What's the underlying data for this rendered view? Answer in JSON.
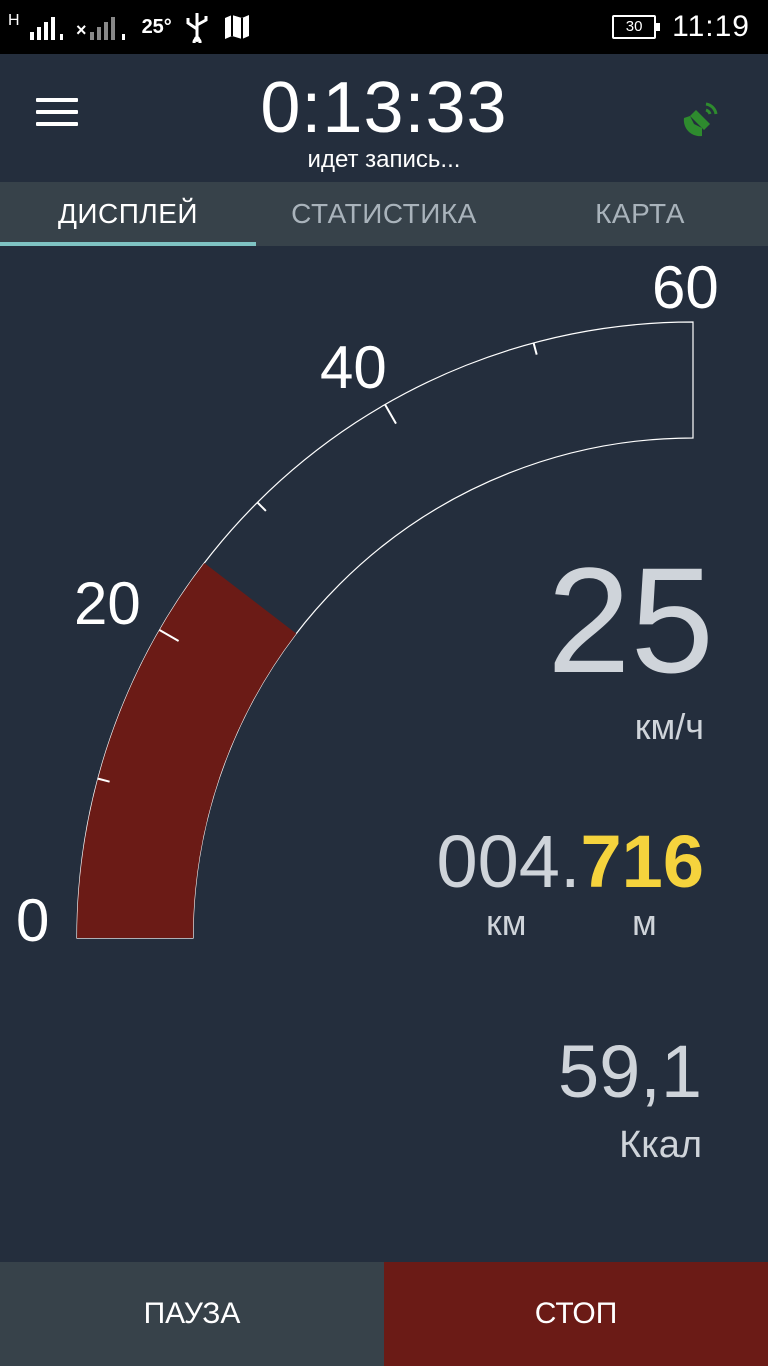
{
  "status_bar": {
    "network1": "H",
    "temperature": "25°",
    "battery": "30",
    "time": "11:19"
  },
  "header": {
    "timer": "0:13:33",
    "status": "идет запись...",
    "menu_icon": "hamburger-menu-icon",
    "gps_icon": "satellite-icon",
    "gps_color": "#2e8b2e"
  },
  "tabs": [
    {
      "label": "ДИСПЛЕЙ",
      "active": true
    },
    {
      "label": "СТАТИСТИКА",
      "active": false
    },
    {
      "label": "КАРТА",
      "active": false
    }
  ],
  "gauge": {
    "min": 0,
    "max": 60,
    "current": 25,
    "fill_color": "#6b1b16",
    "labels": [
      "0",
      "20",
      "40",
      "60"
    ]
  },
  "speed": {
    "value": "25",
    "unit": "км/ч"
  },
  "distance": {
    "km": "004.",
    "m": "716",
    "unit_km": "км",
    "unit_m": "м"
  },
  "calories": {
    "value": "59,1",
    "unit": "Ккал"
  },
  "buttons": {
    "pause": "ПАУЗА",
    "stop": "СТОП"
  }
}
